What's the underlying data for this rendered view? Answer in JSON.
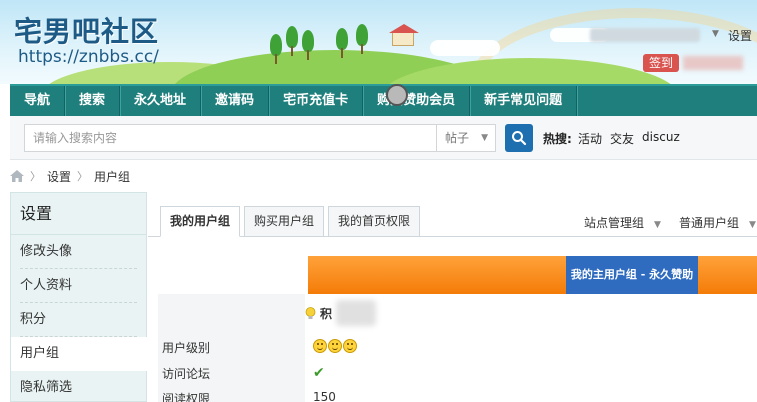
{
  "header": {
    "logo_title": "宅男吧社区",
    "logo_url": "https://znbbs.cc/",
    "user_settings": "设置",
    "checkin": "签到"
  },
  "nav": {
    "items": [
      "导航",
      "搜索",
      "永久地址",
      "邀请码",
      "宅币充值卡",
      "购买赞助会员",
      "新手常见问题"
    ]
  },
  "search": {
    "placeholder": "请输入搜索内容",
    "type_selected": "帖子",
    "hot_label": "热搜:",
    "hot_links": [
      "活动",
      "交友",
      "discuz"
    ]
  },
  "breadcrumb": {
    "items": [
      "设置",
      "用户组"
    ]
  },
  "sidebar": {
    "title": "设置",
    "items": [
      "修改头像",
      "个人资料",
      "积分",
      "用户组",
      "隐私筛选"
    ],
    "active": "用户组"
  },
  "content": {
    "tabs": [
      "我的用户组",
      "购买用户组",
      "我的首页权限"
    ],
    "active_tab": "我的用户组",
    "dropdowns": [
      "站点管理组",
      "普通用户组"
    ],
    "group_title": "我的主用户组 - 永久赞助",
    "credits_label": "积",
    "rows": [
      {
        "label": "用户级别",
        "value": ""
      },
      {
        "label": "访问论坛",
        "value": ""
      },
      {
        "label": "阅读权限",
        "value": "150"
      }
    ]
  },
  "colors": {
    "nav_bg": "#1f7f7c",
    "accent_orange": "#f47c08",
    "group_title_bg": "#2f6cc0",
    "search_button": "#1e6fb0"
  }
}
